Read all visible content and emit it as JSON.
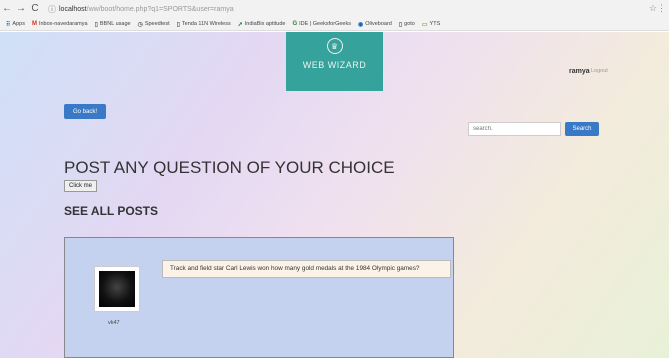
{
  "browser": {
    "url_host": "localhost",
    "url_path": "/ww/boot/home.php?q1=SPORTS&user=ramya",
    "bookmarks": [
      {
        "icon": "apps-grid-icon",
        "label": "Apps"
      },
      {
        "icon": "gmail-icon",
        "label": "Inbox-navedaramya"
      },
      {
        "icon": "page-icon",
        "label": "BBNL usage"
      },
      {
        "icon": "speedometer-icon",
        "label": "Speedtest"
      },
      {
        "icon": "page-icon",
        "label": "Tenda 11N Wireless"
      },
      {
        "icon": "indiabix-icon",
        "label": "IndiaBix aptitude"
      },
      {
        "icon": "geeksforgeeks-icon",
        "label": "IDE | GeeksforGeeks"
      },
      {
        "icon": "oliveboard-icon",
        "label": "Oliveboard"
      },
      {
        "icon": "page-icon",
        "label": "goto"
      },
      {
        "icon": "folder-icon",
        "label": "YTS"
      }
    ]
  },
  "header": {
    "logo_text": "WEB WIZARD",
    "user_name": "ramya",
    "logout_label": "Logout"
  },
  "actions": {
    "back_label": "Go back!",
    "search_placeholder": "search.",
    "search_button_label": "Search",
    "click_me_label": "Click me"
  },
  "main": {
    "title": "POST ANY QUESTION OF YOUR CHOICE",
    "subtitle": "SEE ALL POSTS"
  },
  "posts": [
    {
      "author": "vk47",
      "question": "Track and field star Carl Lewis won how many gold medals at the 1984 Olympic games?"
    }
  ],
  "colors": {
    "logo_bg": "#35a39b",
    "button_blue": "#3a79c5",
    "posts_panel_bg": "#c5d2ef",
    "question_bg": "#fbf3e8"
  }
}
